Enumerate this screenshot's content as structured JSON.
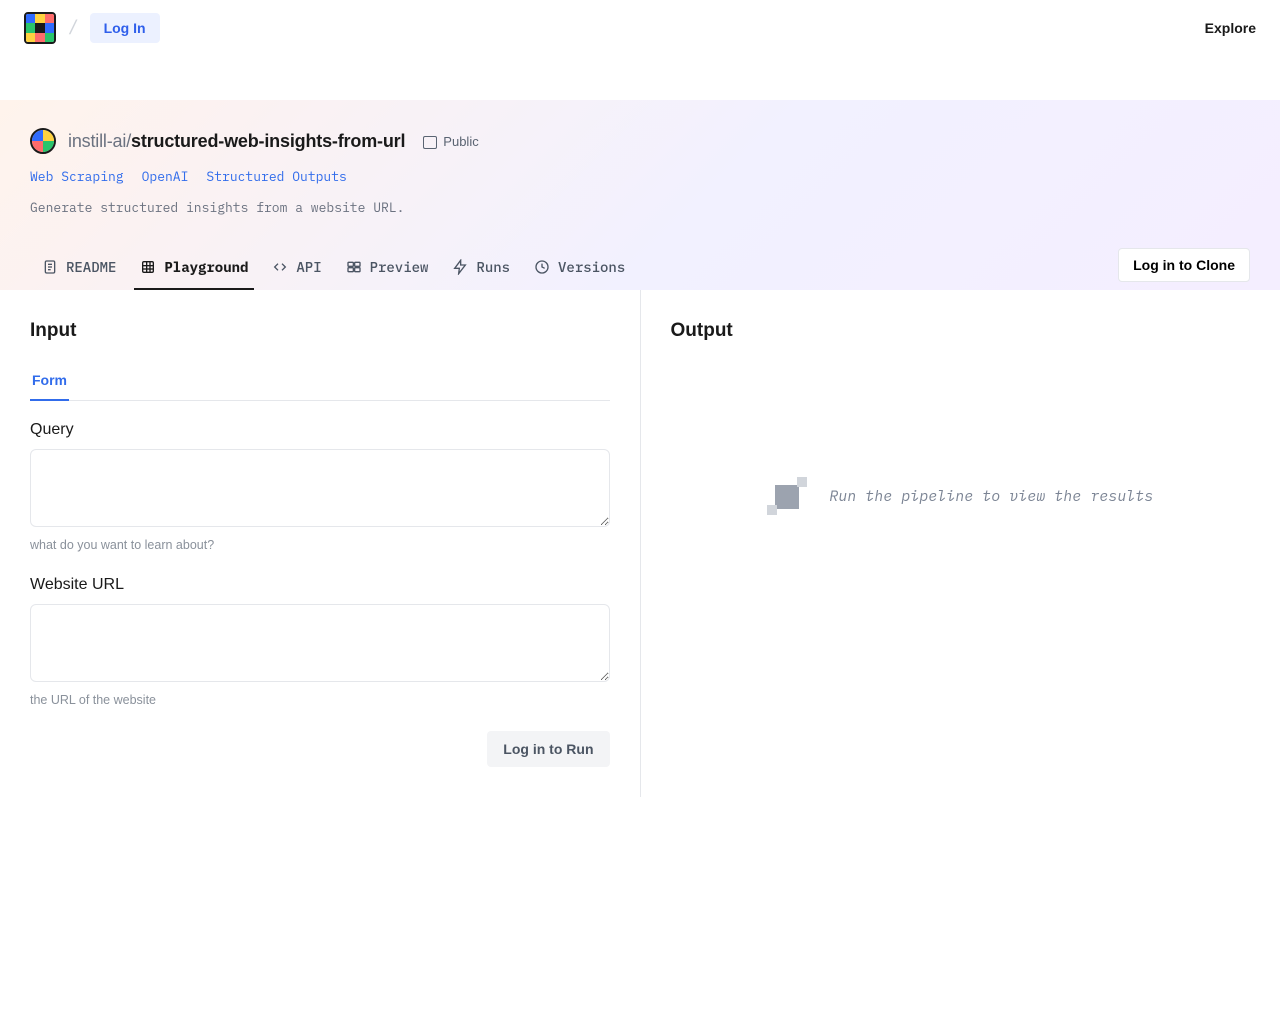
{
  "top": {
    "login": "Log In",
    "explore": "Explore"
  },
  "header": {
    "owner": "instill-ai",
    "slash": "/",
    "name": "structured-web-insights-from-url",
    "visibility": "Public",
    "tags": [
      "Web Scraping",
      "OpenAI",
      "Structured Outputs"
    ],
    "description": "Generate structured insights from a website URL."
  },
  "tabs": {
    "readme": "README",
    "playground": "Playground",
    "api": "API",
    "preview": "Preview",
    "runs": "Runs",
    "versions": "Versions",
    "clone": "Log in to Clone"
  },
  "input": {
    "title": "Input",
    "subtab_form": "Form",
    "query_label": "Query",
    "query_value": "",
    "query_hint": "what do you want to learn about?",
    "url_label": "Website URL",
    "url_value": "",
    "url_hint": "the URL of the website",
    "run_button": "Log in to Run"
  },
  "output": {
    "title": "Output",
    "empty": "Run the pipeline to view the results"
  }
}
